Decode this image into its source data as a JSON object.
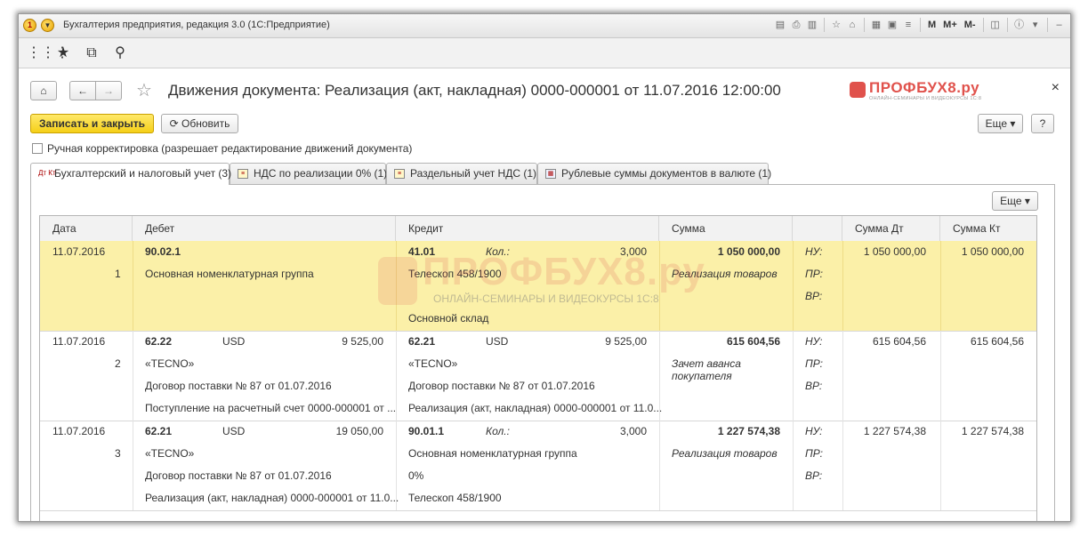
{
  "window": {
    "title": "Бухгалтерия предприятия, редакция 3.0  (1С:Предприятие)",
    "tools": [
      "M",
      "M+",
      "M-"
    ]
  },
  "form": {
    "title": "Движения документа: Реализация (акт, накладная) 0000-000001 от 11.07.2016 12:00:00",
    "close": "×",
    "save_button": "Записать и закрыть",
    "refresh_button": "Обновить",
    "more_button": "Еще",
    "help_button": "?",
    "manual_correction": "Ручная корректировка (разрешает редактирование движений документа)"
  },
  "brand": {
    "name": "ПРОФБУХ8.ру",
    "sub": "ОНЛАЙН-СЕМИНАРЫ И ВИДЕОКУРСЫ 1С:8"
  },
  "tabs": [
    {
      "label": "Бухгалтерский и налоговый учет (3)"
    },
    {
      "label": "НДС по реализации 0% (1)"
    },
    {
      "label": "Раздельный учет НДС (1)"
    },
    {
      "label": "Рублевые суммы документов в валюте (1)"
    }
  ],
  "table": {
    "more_button": "Еще",
    "columns": [
      "Дата",
      "Дебет",
      "Кредит",
      "Сумма",
      "Сумма Дт",
      "Сумма Кт"
    ],
    "rows": [
      {
        "date": "11.07.2016",
        "num": "1",
        "dt_account": "90.02.1",
        "dt_currency": "",
        "dt_amount": "",
        "dt_lines": [
          "Основная номенклатурная группа",
          "",
          ""
        ],
        "kt_account": "41.01",
        "kt_qty_label": "Кол.:",
        "kt_currency": "",
        "kt_amount": "3,000",
        "kt_lines": [
          "Телескоп 458/1900",
          "",
          "Основной склад"
        ],
        "sum": "1 050 000,00",
        "content": "Реализация товаров",
        "types": [
          "НУ:",
          "ПР:",
          "ВР:"
        ],
        "sum_dt": "1 050 000,00",
        "sum_kt": "1 050 000,00"
      },
      {
        "date": "11.07.2016",
        "num": "2",
        "dt_account": "62.22",
        "dt_currency": "USD",
        "dt_amount": "9 525,00",
        "dt_lines": [
          "«TECNO»",
          "Договор поставки № 87 от 01.07.2016",
          "Поступление на расчетный счет 0000-000001 от ..."
        ],
        "kt_account": "62.21",
        "kt_qty_label": "",
        "kt_currency": "USD",
        "kt_amount": "9 525,00",
        "kt_lines": [
          "«TECNO»",
          "Договор поставки № 87 от 01.07.2016",
          "Реализация (акт, накладная) 0000-000001 от 11.0..."
        ],
        "sum": "615 604,56",
        "content": "Зачет аванса покупателя",
        "types": [
          "НУ:",
          "ПР:",
          "ВР:"
        ],
        "sum_dt": "615 604,56",
        "sum_kt": "615 604,56"
      },
      {
        "date": "11.07.2016",
        "num": "3",
        "dt_account": "62.21",
        "dt_currency": "USD",
        "dt_amount": "19 050,00",
        "dt_lines": [
          "«TECNO»",
          "Договор поставки № 87 от 01.07.2016",
          "Реализация (акт, накладная) 0000-000001 от 11.0..."
        ],
        "kt_account": "90.01.1",
        "kt_qty_label": "Кол.:",
        "kt_currency": "",
        "kt_amount": "3,000",
        "kt_lines": [
          "Основная номенклатурная группа",
          "0%",
          "Телескоп 458/1900"
        ],
        "sum": "1 227 574,38",
        "content": "Реализация товаров",
        "types": [
          "НУ:",
          "ПР:",
          "ВР:"
        ],
        "sum_dt": "1 227 574,38",
        "sum_kt": "1 227 574,38"
      }
    ]
  },
  "colors": {
    "selected_row": "#fbf0a8",
    "save_button": "#f5cf18",
    "brand": "#e0524c"
  }
}
